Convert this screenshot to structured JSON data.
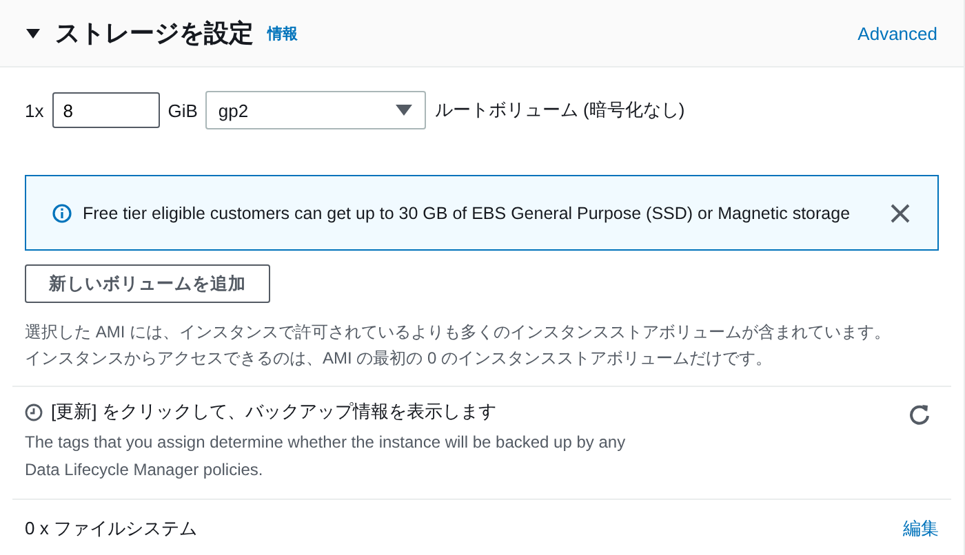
{
  "section": {
    "title": "ストレージを設定",
    "expanded": true,
    "info_link": "情報",
    "advanced_link": "Advanced"
  },
  "volumes": [
    {
      "count": "1x",
      "size": "8",
      "unit": "GiB",
      "type": "gp2",
      "description": "ルートボリューム (暗号化なし)"
    }
  ],
  "alert": {
    "text": "Free tier eligible customers can get up to 30 GB of EBS General Purpose (SSD) or Magnetic storage",
    "dismissible": true
  },
  "add_volume_button": "新しいボリュームを追加",
  "ami_notice": [
    "選択した AMI には、インスタンスで許可されているよりも多くのインスタンスストアボリュームが含まれています。",
    "インスタンスからアクセスできるのは、AMI の最初の 0 のインスタンスストアボリュームだけです。"
  ],
  "backup": {
    "title": "[更新] をクリックして、バックアップ情報を表示します",
    "description": [
      "The tags that you assign determine whether the instance will be backed up by any",
      "Data Lifecycle Manager policies."
    ]
  },
  "file_systems": {
    "label": "0 x ファイルシステム",
    "edit_link": "編集"
  }
}
